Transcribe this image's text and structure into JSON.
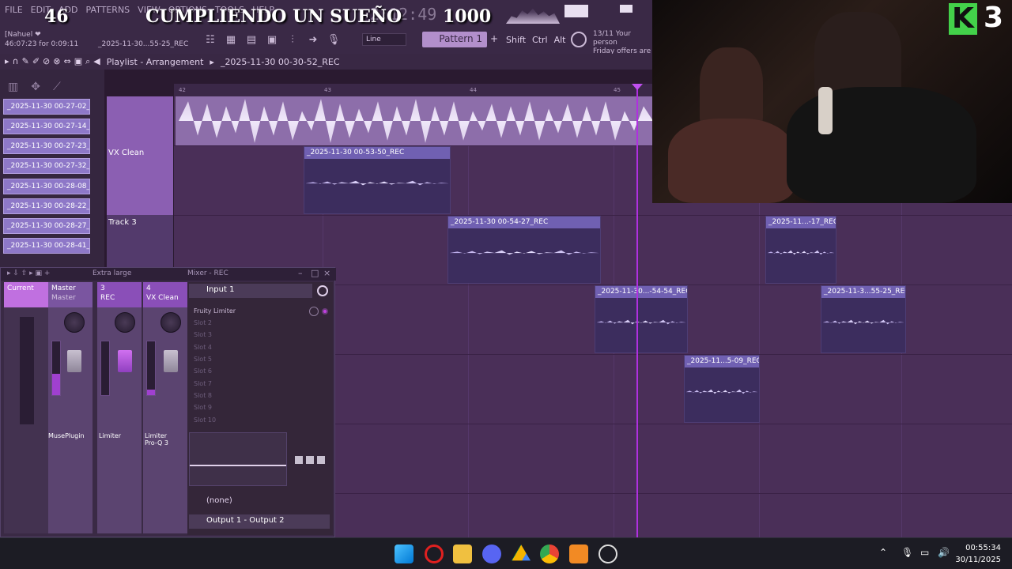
{
  "menu": [
    "FILE",
    "EDIT",
    "ADD",
    "PATTERNS",
    "VIEW",
    "OPTIONS",
    "TOOLS",
    "HELP"
  ],
  "overlay": {
    "left_number": "46",
    "title": "CUMPLIENDO UN SUEÑO",
    "right_number": "1000",
    "time": "2:12:49"
  },
  "user": {
    "name": "[Nahuel ❤",
    "session": "46:07:23 for 0:09:11"
  },
  "file_info": "_2025-11-30...55-25_REC",
  "toolbar": {
    "line_label": "Line",
    "pattern_label": "Pattern 1",
    "pattern_add": "+",
    "modifiers": [
      "Shift",
      "Ctrl",
      "Alt"
    ]
  },
  "news": {
    "line1": "13/11 Your person",
    "line2": "Friday offers are h"
  },
  "playlist": {
    "title": "Playlist - Arrangement",
    "breadcrumb": "_2025-11-30 00-30-52_REC"
  },
  "ruler": [
    "42",
    "43",
    "44",
    "45"
  ],
  "browser_items": [
    "_2025-11-30 00-27-02_R...",
    "_2025-11-30 00-27-14_R...",
    "_2025-11-30 00-27-23_R...",
    "_2025-11-30 00-27-32_R...",
    "_2025-11-30 00-28-08_R...",
    "_2025-11-30 00-28-22_R...",
    "_2025-11-30 00-28-27_R...",
    "_2025-11-30 00-28-41_R..."
  ],
  "tracks": [
    {
      "name": ""
    },
    {
      "name": "VX Clean"
    },
    {
      "name": "Track 3"
    }
  ],
  "clips": [
    {
      "label": "_2025-11-30 00-53-50_REC"
    },
    {
      "label": "_2025-11-30 00-54-27_REC"
    },
    {
      "label": "_2025-11...-17_REC"
    },
    {
      "label": "_2025-11-30...-54-54_REC"
    },
    {
      "label": "_2025-11-3...55-25_REC"
    },
    {
      "label": "_2025-11...5-09_REC"
    }
  ],
  "mixer": {
    "title": "Mixer - REC",
    "preset": "Extra large",
    "strips": [
      {
        "num": "",
        "name": "Current",
        "sub": "",
        "plugin": ""
      },
      {
        "num": "",
        "name": "Master",
        "sub": "Master",
        "plugin": "MusePlugin"
      },
      {
        "num": "3",
        "name": "REC",
        "sub": "",
        "plugin": "Limiter"
      },
      {
        "num": "4",
        "name": "VX Clean",
        "sub": "",
        "plugin": "Limiter\nPro-Q 3"
      }
    ],
    "input": "Input 1",
    "slots": [
      "Fruity Limiter",
      "Slot 2",
      "Slot 3",
      "Slot 4",
      "Slot 5",
      "Slot 6",
      "Slot 7",
      "Slot 8",
      "Slot 9",
      "Slot 10"
    ],
    "send": "(none)",
    "output": "Output 1 - Output 2"
  },
  "webcam": {
    "logo_letter": "K",
    "logo_number": "3"
  },
  "clock": {
    "time": "00:55:34",
    "date": "30/11/2025"
  },
  "colors": {
    "accent": "#8b5fb2",
    "clip": "#7060b2",
    "playhead": "#b030e0",
    "logo": "#43d14a"
  }
}
